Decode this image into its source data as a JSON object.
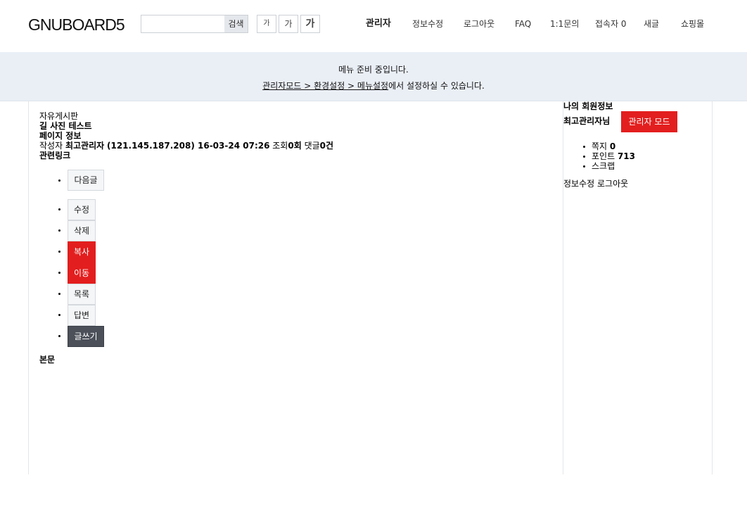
{
  "header": {
    "logo": "GNUBOARD5",
    "search_placeholder": "",
    "search_button": "검색",
    "font_small": "가",
    "font_medium": "가",
    "font_large": "가",
    "nav": [
      "관리자",
      "정보수정",
      "로그아웃",
      "FAQ",
      "1:1문의",
      "접속자 0",
      "새글",
      "쇼핑몰"
    ]
  },
  "notice": {
    "line1": "메뉴 준비 중입니다.",
    "link1": "관리자모드 > 환경설정 > 메뉴설정",
    "line2_suffix": "에서 설정하실 수 있습니다."
  },
  "post": {
    "board_name": "자유게시판",
    "title": "길 사진 테스트",
    "page_info": "페이지 정보",
    "meta_prefix": "작성자",
    "author": "최고관리자",
    "meta_ip_date": "(121.145.187.208) 16-03-24 07:26",
    "views_label": "조회",
    "views_value": "0회",
    "comments_label": "댓글",
    "comments_value": "0건",
    "related_links": "관련링크",
    "body_heading": "본문"
  },
  "buttons": {
    "next": "다음글",
    "edit": "수정",
    "delete": "삭제",
    "copy": "복사",
    "move": "이동",
    "list": "목록",
    "reply": "답변",
    "write": "글쓰기"
  },
  "aside": {
    "heading": "나의 회원정보",
    "nickname": "최고관리자님",
    "admin_mode": "관리자 모드",
    "memo_label": "쪽지",
    "memo_value": "0",
    "point_label": "포인트",
    "point_value": "713",
    "scrap_label": "스크랩",
    "edit_link": "정보수정",
    "logout_link": "로그아웃"
  },
  "colors": {
    "accent_red": "#e31e1e",
    "notice_bg": "#eaeff6",
    "dark_button": "#4b5059"
  }
}
